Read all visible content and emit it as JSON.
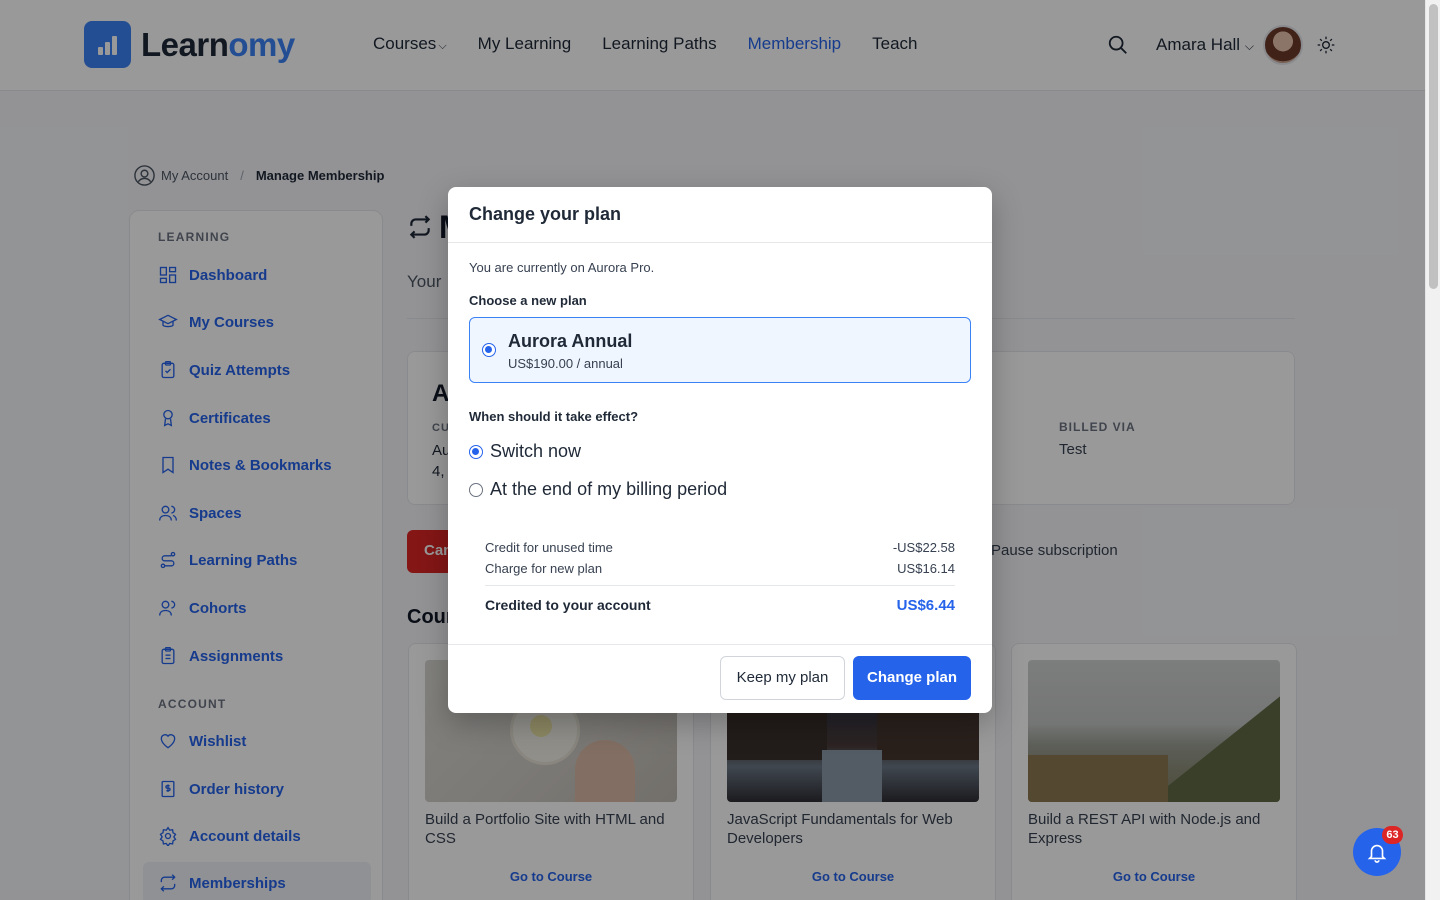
{
  "header": {
    "logo_learn": "Learn",
    "logo_omy": "omy",
    "nav": {
      "courses": "Courses",
      "my_learning": "My Learning",
      "learning_paths": "Learning Paths",
      "membership": "Membership",
      "teach": "Teach"
    },
    "user_name": "Amara Hall"
  },
  "breadcrumb": {
    "account": "My Account",
    "separator": "/",
    "current": "Manage Membership"
  },
  "sidebar": {
    "learning_title": "LEARNING",
    "account_title": "ACCOUNT",
    "items": [
      {
        "label": "Dashboard"
      },
      {
        "label": "My Courses"
      },
      {
        "label": "Quiz Attempts"
      },
      {
        "label": "Certificates"
      },
      {
        "label": "Notes & Bookmarks"
      },
      {
        "label": "Spaces"
      },
      {
        "label": "Learning Paths"
      },
      {
        "label": "Cohorts"
      },
      {
        "label": "Assignments"
      },
      {
        "label": "Wishlist"
      },
      {
        "label": "Order history"
      },
      {
        "label": "Account details"
      },
      {
        "label": "Memberships"
      }
    ]
  },
  "main": {
    "title_partial": "M",
    "subtitle_partial": "Your",
    "plan_title_partial": "A",
    "plan_label_partial": "CU",
    "plan_value1_partial": "Au",
    "plan_value2_partial": "4,",
    "billed_label": "BILLED VIA",
    "billed_value": "Test",
    "cancel_partial": "Can",
    "pause_label": "Pause subscription",
    "courses_title_partial": "Cour",
    "courses": [
      {
        "name": "Build a Portfolio Site with HTML and CSS",
        "link": "Go to Course"
      },
      {
        "name": "JavaScript Fundamentals for Web Developers",
        "link": "Go to Course"
      },
      {
        "name": "Build a REST API with Node.js and Express",
        "link": "Go to Course"
      }
    ]
  },
  "modal": {
    "title": "Change your plan",
    "current_text": "You are currently on Aurora Pro.",
    "choose_label": "Choose a new plan",
    "plan_option": {
      "name": "Aurora Annual",
      "price": "US$190.00 / annual",
      "selected": true
    },
    "when_label": "When should it take effect?",
    "timing_options": [
      {
        "label": "Switch now",
        "selected": true
      },
      {
        "label": "At the end of my billing period",
        "selected": false
      }
    ],
    "summary": {
      "credit_label": "Credit for unused time",
      "credit_value": "-US$22.58",
      "charge_label": "Charge for new plan",
      "charge_value": "US$16.14",
      "total_label": "Credited to your account",
      "total_value": "US$6.44"
    },
    "keep_button": "Keep my plan",
    "change_button": "Change plan"
  },
  "notifications": {
    "count": "63"
  },
  "colors": {
    "accent": "#2563eb",
    "danger": "#dc2626"
  }
}
